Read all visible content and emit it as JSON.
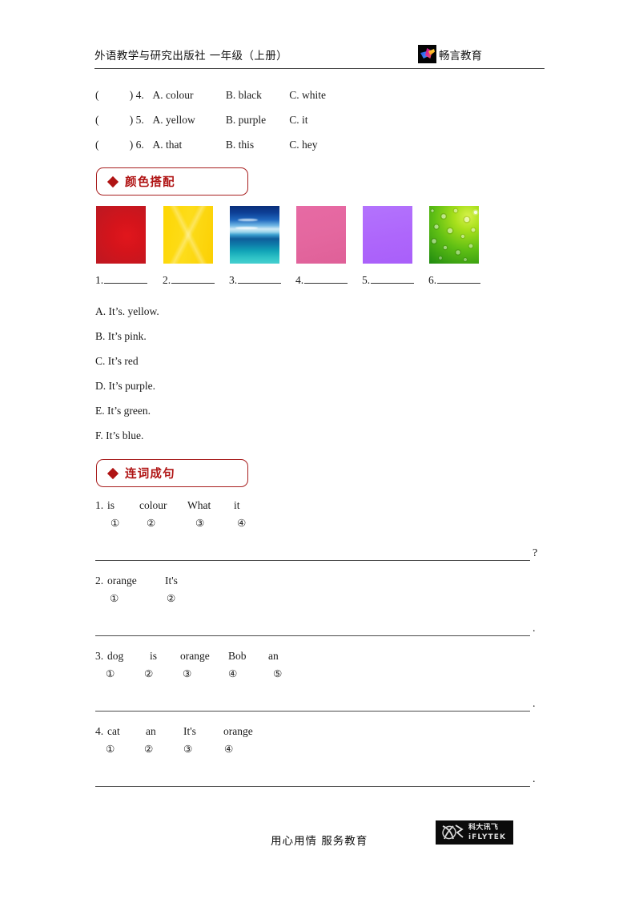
{
  "header": {
    "title": "外语教学与研究出版社  一年级（上册）",
    "brand_name": "畅言教育",
    "logo_icon": "changyan-bird-logo"
  },
  "multiple_choice": {
    "rows": [
      {
        "paren_open": "(",
        "paren_close": ")",
        "number": "4.",
        "a": "A. colour",
        "b": "B. black",
        "c": "C. white"
      },
      {
        "paren_open": "(",
        "paren_close": ")",
        "number": "5.",
        "a": "A. yellow",
        "b": "B. purple",
        "c": "C. it"
      },
      {
        "paren_open": "(",
        "paren_close": ")",
        "number": "6.",
        "a": "A. that",
        "b": "B. this",
        "c": "C. hey"
      }
    ]
  },
  "sections": {
    "colors": {
      "label": "颜色搭配",
      "bullet": "diamond-bullet"
    },
    "word_order": {
      "label": "连词成句",
      "bullet": "diamond-bullet"
    }
  },
  "color_match": {
    "swatches": [
      {
        "name": "red-swatch",
        "color": "#d4141b",
        "label": "red gradient"
      },
      {
        "name": "yellow-swatch",
        "color": "#fcd705",
        "label": "yellow faceted"
      },
      {
        "name": "blue-swatch",
        "color": "#1f8ec4",
        "label": "blue ocean sky"
      },
      {
        "name": "pink-swatch",
        "color": "#e4679f",
        "label": "pink"
      },
      {
        "name": "purple-swatch",
        "color": "#ae66fb",
        "label": "purple"
      },
      {
        "name": "green-swatch",
        "color": "#6cc41a",
        "label": "green water drops"
      }
    ],
    "blanks": [
      "1.",
      "2.",
      "3.",
      "4.",
      "5.",
      "6."
    ],
    "options": [
      "A. It’s. yellow.",
      "B. It’s pink.",
      "C. It’s red",
      "D. It’s purple.",
      "E. It’s green.",
      "F. It’s blue."
    ]
  },
  "word_order": {
    "items": [
      {
        "number": "1.",
        "words": [
          "is",
          "colour",
          "What",
          "it"
        ],
        "marks": [
          "①",
          "②",
          "③",
          "④"
        ],
        "end_punct": "?"
      },
      {
        "number": "2.",
        "words": [
          "orange",
          "It's"
        ],
        "marks": [
          "①",
          "②"
        ],
        "end_punct": "."
      },
      {
        "number": "3.",
        "words": [
          "dog",
          "is",
          "orange",
          "Bob",
          "an"
        ],
        "marks": [
          "①",
          "②",
          "③",
          "④",
          "⑤"
        ],
        "end_punct": "."
      },
      {
        "number": "4.",
        "words": [
          "cat",
          "an",
          "It's",
          "orange"
        ],
        "marks": [
          "①",
          "②",
          "③",
          "④"
        ],
        "end_punct": "."
      }
    ]
  },
  "footer": {
    "slogan": "用心用情   服务教育",
    "logo_cn": "科大讯飞",
    "logo_en": "iFLYTEK",
    "logo_icon": "iflytek-logo"
  }
}
